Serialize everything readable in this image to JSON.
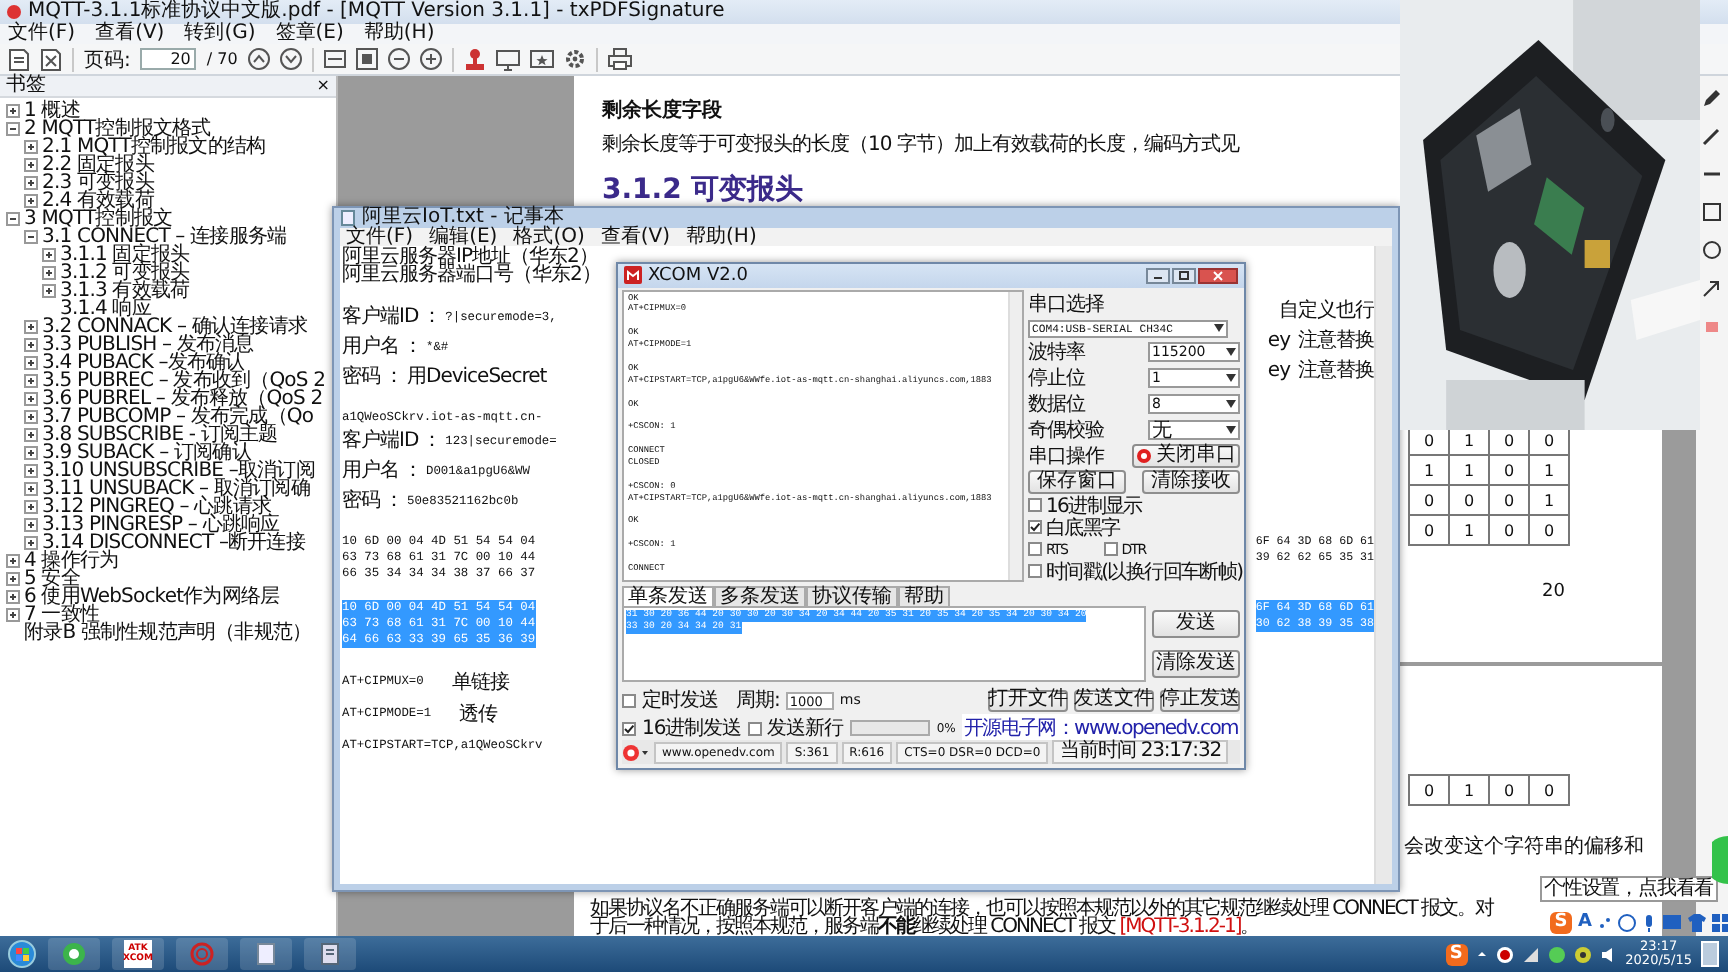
{
  "pdf_viewer": {
    "title": "MQTT-3.1.1标准协议中文版.pdf - [MQTT Version 3.1.1] - txPDFSignature",
    "menu": [
      "文件(F)",
      "查看(V)",
      "转到(G)",
      "签章(E)",
      "帮助(H)"
    ],
    "page_label": "页码:",
    "page_field": "20",
    "page_total": "/ 70",
    "bookmarks_title": "书签",
    "bookmarks_close": "×",
    "bookmarks": [
      {
        "label": "1 概述",
        "kind": "branch",
        "expanded": false
      },
      {
        "label": "2 MQTT控制报文格式",
        "kind": "branch",
        "expanded": true,
        "children": [
          {
            "label": "2.1 MQTT控制报文的结构",
            "kind": "branch",
            "expanded": false
          },
          {
            "label": "2.2 固定报头",
            "kind": "branch",
            "expanded": false
          },
          {
            "label": "2.3 可变报头",
            "kind": "branch",
            "expanded": false
          },
          {
            "label": "2.4 有效载荷",
            "kind": "branch",
            "expanded": false
          }
        ]
      },
      {
        "label": "3 MQTT控制报文",
        "kind": "branch",
        "expanded": true,
        "children": [
          {
            "label": "3.1 CONNECT – 连接服务端",
            "kind": "branch",
            "expanded": true,
            "children": [
              {
                "label": "3.1.1 固定报头",
                "kind": "branch",
                "expanded": false
              },
              {
                "label": "3.1.2 可变报头",
                "kind": "branch",
                "expanded": false
              },
              {
                "label": "3.1.3 有效载荷",
                "kind": "branch",
                "expanded": false
              },
              {
                "label": "3.1.4 响应",
                "kind": "leaf"
              }
            ]
          },
          {
            "label": "3.2 CONNACK – 确认连接请求",
            "kind": "branch",
            "expanded": false
          },
          {
            "label": "3.3 PUBLISH – 发布消息",
            "kind": "branch",
            "expanded": false
          },
          {
            "label": "3.4 PUBACK –发布确认",
            "kind": "branch",
            "expanded": false
          },
          {
            "label": "3.5 PUBREC – 发布收到（QoS 2",
            "kind": "branch",
            "expanded": false
          },
          {
            "label": "3.6 PUBREL – 发布释放（QoS 2",
            "kind": "branch",
            "expanded": false
          },
          {
            "label": "3.7 PUBCOMP – 发布完成（Qo",
            "kind": "branch",
            "expanded": false
          },
          {
            "label": "3.8 SUBSCRIBE - 订阅主题",
            "kind": "branch",
            "expanded": false
          },
          {
            "label": "3.9 SUBACK – 订阅确认",
            "kind": "branch",
            "expanded": false
          },
          {
            "label": "3.10 UNSUBSCRIBE –取消订阅",
            "kind": "branch",
            "expanded": false
          },
          {
            "label": "3.11 UNSUBACK – 取消订阅确",
            "kind": "branch",
            "expanded": false
          },
          {
            "label": "3.12 PINGREQ – 心跳请求",
            "kind": "branch",
            "expanded": false
          },
          {
            "label": "3.13 PINGRESP – 心跳响应",
            "kind": "branch",
            "expanded": false
          },
          {
            "label": "3.14 DISCONNECT –断开连接",
            "kind": "branch",
            "expanded": false
          }
        ]
      },
      {
        "label": "4 操作行为",
        "kind": "branch",
        "expanded": false
      },
      {
        "label": "5 安全",
        "kind": "branch",
        "expanded": false
      },
      {
        "label": "6 使用WebSocket作为网络层",
        "kind": "branch",
        "expanded": false
      },
      {
        "label": "7 一致性",
        "kind": "branch",
        "expanded": false
      },
      {
        "label": "附录B 强制性规范声明（非规范）",
        "kind": "leaf"
      }
    ],
    "page": {
      "subheading": "剩余长度字段",
      "paragraph": "剩余长度等于可变报头的长度（10 字节）加上有效载荷的长度，编码方式见",
      "section": "3.1.2 可变报头",
      "table_rows": [
        [
          "0",
          "1",
          "0",
          "0"
        ],
        [
          "1",
          "1",
          "0",
          "1"
        ],
        [
          "0",
          "0",
          "0",
          "1"
        ],
        [
          "0",
          "1",
          "0",
          "0"
        ]
      ],
      "page_number": "20",
      "table_rows_2": [
        [
          "0",
          "1",
          "0",
          "0"
        ]
      ],
      "fragment": "会改变这个字符串的偏移和",
      "bottom_line_1": "如果协议名不正确服务端可以断开客户端的连接，也可以按照本规范以外的其它规范继续处理 CONNECT 报文。对",
      "bottom_line_2": "于后一种情况，按照本规范，服务端**不能**继续处理 CONNECT 报文 ",
      "bottom_ref": "[MQTT-3.1.2-1]",
      "bottom_end": "。"
    }
  },
  "notepad": {
    "title": "阿里云IoT.txt - 记事本",
    "menu": [
      "文件(F)",
      "编辑(E)",
      "格式(O)",
      "查看(V)",
      "帮助(H)"
    ],
    "lines": [
      {
        "kind": "plain",
        "text": "阿里云服务器IP地址（华东2）",
        "selected": false
      },
      {
        "kind": "plain",
        "text": "阿里云服务器端口号（华东2）",
        "selected": false
      },
      {
        "kind": "blank",
        "selected": false
      },
      {
        "kind": "field",
        "label": "客户端ID",
        "sep": "：",
        "value": "?|securemode=3,",
        "right": "自定义也行",
        "selected": false
      },
      {
        "kind": "field",
        "label": "用户名",
        "sep": "：",
        "value": "*&#",
        "right": "ey",
        "right_note": "注意替换",
        "selected": false
      },
      {
        "kind": "field",
        "label": "密码",
        "sep": "：",
        "value": "用DeviceSecret",
        "right": "ey",
        "right_note": "注意替换",
        "selected": false
      },
      {
        "kind": "blank",
        "selected": false
      },
      {
        "kind": "code",
        "text": "a1QWeoSCkrv.iot-as-mqtt.cn-",
        "selected": false
      },
      {
        "kind": "field",
        "label": "客户端ID",
        "sep": "：",
        "value": "123|securemode=",
        "selected": false
      },
      {
        "kind": "field",
        "label": "用户名",
        "sep": "：",
        "value": "D001&a1pgU6&WW",
        "selected": false
      },
      {
        "kind": "field",
        "label": "密码",
        "sep": "：",
        "value": "50e83521162bc0b",
        "selected": false
      },
      {
        "kind": "blank",
        "selected": false
      },
      {
        "kind": "code",
        "text": "10 6D 00 04 4D 51 54 54 04",
        "right": "6F 64 3D 68 6D 61",
        "selected": false
      },
      {
        "kind": "code",
        "text": "63 73 68 61 31 7C 00 10 44",
        "right": "39 62 62 65 35 31",
        "selected": false
      },
      {
        "kind": "code",
        "text": "66 35 34 34 34 38 37 66 37",
        "selected": false
      },
      {
        "kind": "blank",
        "selected": false
      },
      {
        "kind": "code",
        "text": "10 6D 00 04 4D 51 54 54 04",
        "right": "6F 64 3D 68 6D 61",
        "selected": true
      },
      {
        "kind": "code",
        "text": "63 73 68 61 31 7C 00 10 44",
        "right": "30 62 38 39 35 38",
        "selected": true
      },
      {
        "kind": "code",
        "text": "64 66 63 33 39 65 35 36 39",
        "selected": true
      },
      {
        "kind": "blank",
        "selected": false
      },
      {
        "kind": "cmd",
        "text": "AT+CIPMUX=0",
        "note": "单链接",
        "selected": false
      },
      {
        "kind": "cmd",
        "text": "AT+CIPMODE=1",
        "note": "透传",
        "selected": false
      },
      {
        "kind": "cmd",
        "text": "AT+CIPSTART=TCP,a1QWeoSCkrv",
        "selected": false
      }
    ]
  },
  "xcom": {
    "title": "XCOM V2.0",
    "receive_blocks": [
      [
        "OK",
        "AT+CIPMUX=0"
      ],
      [
        "OK",
        "AT+CIPMODE=1"
      ],
      [
        "OK",
        "AT+CIPSTART=TCP,a1pgU6&WWfe.iot-as-mqtt.cn-shanghai.aliyuncs.com,1883"
      ],
      [
        "OK"
      ],
      [
        "+CSCON: 1"
      ],
      [
        "CONNECT",
        "CLOSED"
      ],
      [
        "+CSCON: 0",
        "AT+CIPSTART=TCP,a1pgU6&WWfe.iot-as-mqtt.cn-shanghai.aliyuncs.com,1883"
      ],
      [
        "OK"
      ],
      [
        "+CSCON: 1"
      ],
      [
        "CONNECT"
      ]
    ],
    "port_label": "串口选择",
    "port": "COM4:USB-SERIAL CH34C",
    "settings": [
      {
        "label": "波特率",
        "value": "115200"
      },
      {
        "label": "停止位",
        "value": "1"
      },
      {
        "label": "数据位",
        "value": "8"
      },
      {
        "label": "奇偶校验",
        "value": "无"
      }
    ],
    "port_op_label": "串口操作",
    "port_button": "关闭串口",
    "buttons": [
      "保存窗口",
      "清除接收"
    ],
    "options": [
      {
        "label": "16进制显示",
        "checked": false
      },
      {
        "label": "白底黑字",
        "checked": true
      },
      {
        "label": "RTS",
        "checked": false
      },
      {
        "label": "DTR",
        "checked": false
      },
      {
        "label": "时间戳(以换行回车断帧)",
        "checked": false
      }
    ],
    "tabs": [
      {
        "label": "单条发送",
        "selected": true
      },
      {
        "label": "多条发送",
        "selected": false
      },
      {
        "label": "协议传输",
        "selected": false
      },
      {
        "label": "帮助",
        "selected": false
      }
    ],
    "send_lines": [
      "31 30 20 36 44 20 30 30 20 30 34 20 34 44 20 35 31 20 35 34 20 35 34 20 30 34 20",
      "33 30 20 34 34 20 31"
    ],
    "send_buttons": [
      "发送",
      "清除发送"
    ],
    "timer": {
      "label": "定时发送",
      "checked": false
    },
    "period_label": "周期:",
    "period": "1000",
    "period_unit": "ms",
    "file_buttons": [
      "打开文件",
      "发送文件",
      "停止发送"
    ],
    "send_options": [
      {
        "label": "16进制发送",
        "checked": true
      },
      {
        "label": "发送新行",
        "checked": false
      }
    ],
    "progress": {
      "level": 0,
      "reading": "0%"
    },
    "site_text": "开源电子网：www.openedv.com",
    "status": {
      "url": "www.openedv.com",
      "sent": "S:361",
      "received": "R:616",
      "lines": "CTS=0 DSR=0 DCD=0",
      "time": "当前时间 23:17:32"
    }
  },
  "tooltip": "个性设置，点我看看",
  "ime": {
    "logo": "S",
    "mode": "A"
  },
  "taskbar": {
    "xcom_icon": [
      "ATK",
      "XCOM"
    ],
    "tray_logo": "S",
    "time": "23:17",
    "date": "2020/5/15"
  }
}
